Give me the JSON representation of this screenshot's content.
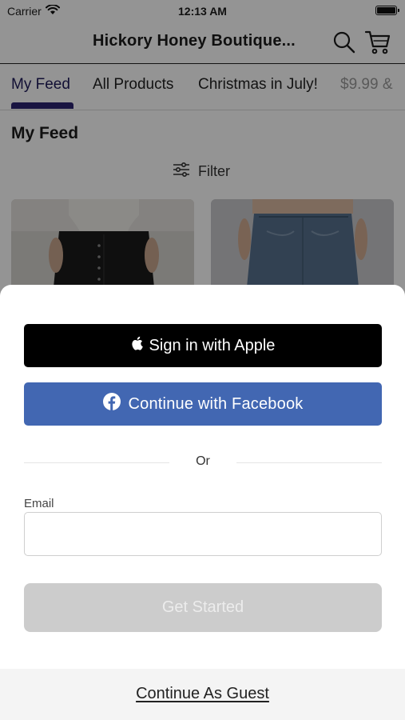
{
  "status_bar": {
    "carrier": "Carrier",
    "time": "12:13 AM"
  },
  "nav": {
    "title": "Hickory Honey Boutique...",
    "search_icon": "search-icon",
    "cart_icon": "cart-icon"
  },
  "tabs": [
    {
      "label": "My Feed",
      "active": true
    },
    {
      "label": "All Products",
      "active": false
    },
    {
      "label": "Christmas in July!",
      "active": false
    },
    {
      "label": "$9.99 &",
      "active": false
    }
  ],
  "feed": {
    "title": "My Feed",
    "filter_label": "Filter"
  },
  "sheet": {
    "apple_label": "Sign in with Apple",
    "facebook_label": "Continue with Facebook",
    "or_label": "Or",
    "email_label": "Email",
    "email_value": "",
    "email_placeholder": "",
    "get_started_label": "Get Started",
    "guest_label": "Continue As Guest"
  },
  "colors": {
    "facebook_blue": "#4267b2",
    "apple_black": "#000000",
    "tab_accent": "#2c2470",
    "disabled_button": "#cccccc"
  }
}
